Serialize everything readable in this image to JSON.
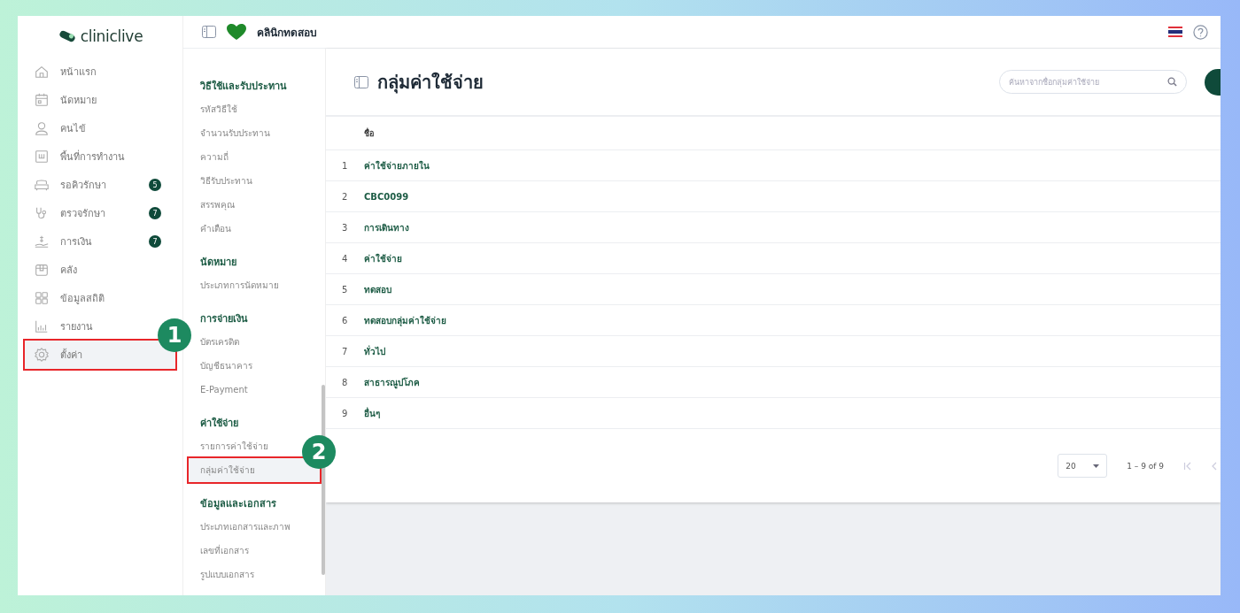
{
  "logo": {
    "text": "cliniclive"
  },
  "sidebar": {
    "items": [
      {
        "label": "หน้าแรก",
        "selected": false
      },
      {
        "label": "นัดหมาย",
        "selected": false
      },
      {
        "label": "คนไข้",
        "selected": false
      },
      {
        "label": "พื้นที่การทำงาน",
        "selected": false
      },
      {
        "label": "รอคิวรักษา",
        "badge": "5",
        "selected": false
      },
      {
        "label": "ตรวจรักษา",
        "badge": "7",
        "selected": false
      },
      {
        "label": "การเงิน",
        "badge": "7",
        "selected": false
      },
      {
        "label": "คลัง",
        "selected": false
      },
      {
        "label": "ข้อมูลสถิติ",
        "selected": false
      },
      {
        "label": "รายงาน",
        "selected": false
      },
      {
        "label": "ตั้งค่า",
        "selected": true,
        "annotation": "1"
      }
    ]
  },
  "header": {
    "clinic_name": "คลินิกทดสอบ"
  },
  "submenu": {
    "sections": [
      {
        "title": "วิธีใช้และรับประทาน",
        "items": [
          {
            "label": "รหัสวิธีใช้",
            "selected": false
          },
          {
            "label": "จำนวนรับประทาน",
            "selected": false
          },
          {
            "label": "ความถี่",
            "selected": false
          },
          {
            "label": "วิธีรับประทาน",
            "selected": false
          },
          {
            "label": "สรรพคุณ",
            "selected": false
          },
          {
            "label": "คำเตือน",
            "selected": false
          }
        ]
      },
      {
        "title": "นัดหมาย",
        "items": [
          {
            "label": "ประเภทการนัดหมาย",
            "selected": false
          }
        ]
      },
      {
        "title": "การจ่ายเงิน",
        "items": [
          {
            "label": "บัตรเครดิต",
            "selected": false
          },
          {
            "label": "บัญชีธนาคาร",
            "selected": false
          },
          {
            "label": "E-Payment",
            "selected": false
          }
        ]
      },
      {
        "title": "ค่าใช้จ่าย",
        "items": [
          {
            "label": "รายการค่าใช้จ่าย",
            "selected": false
          },
          {
            "label": "กลุ่มค่าใช้จ่าย",
            "selected": true,
            "annotation": "2"
          }
        ]
      },
      {
        "title": "ข้อมูลและเอกสาร",
        "items": [
          {
            "label": "ประเภทเอกสารและภาพ",
            "selected": false
          },
          {
            "label": "เลขที่เอกสาร",
            "selected": false
          },
          {
            "label": "รูปแบบเอกสาร",
            "selected": false
          }
        ]
      }
    ]
  },
  "page": {
    "title": "กลุ่มค่าใช้จ่าย",
    "search": {
      "placeholder": "ค้นหาจากชื่อกลุ่มค่าใช้จ่าย"
    },
    "table": {
      "columns": [
        "ชื่อ"
      ],
      "rows": [
        {
          "index": "1",
          "name": "ค่าใช้จ่ายภายใน"
        },
        {
          "index": "2",
          "name": "CBC0099"
        },
        {
          "index": "3",
          "name": "การเดินทาง"
        },
        {
          "index": "4",
          "name": "ค่าใช้จ่าย"
        },
        {
          "index": "5",
          "name": "ทดสอบ"
        },
        {
          "index": "6",
          "name": "ทดสอบกลุ่มค่าใช้จ่าย"
        },
        {
          "index": "7",
          "name": "ทั่วไป"
        },
        {
          "index": "8",
          "name": "สาธารณูปโภค"
        },
        {
          "index": "9",
          "name": "อื่นๆ"
        }
      ]
    },
    "pagination": {
      "page_size": "20",
      "range": "1 – 9 of 9"
    }
  }
}
